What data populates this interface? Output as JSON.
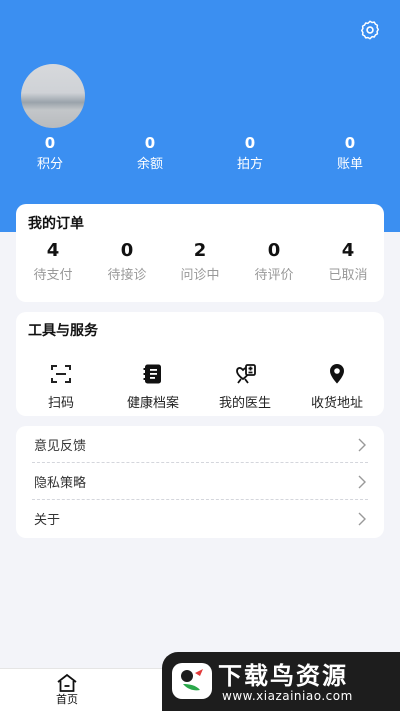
{
  "profile": {
    "stats": [
      {
        "value": "0",
        "label": "积分"
      },
      {
        "value": "0",
        "label": "余额"
      },
      {
        "value": "0",
        "label": "拍方"
      },
      {
        "value": "0",
        "label": "账单"
      }
    ]
  },
  "orders": {
    "title": "我的订单",
    "items": [
      {
        "value": "4",
        "label": "待支付"
      },
      {
        "value": "0",
        "label": "待接诊"
      },
      {
        "value": "2",
        "label": "问诊中"
      },
      {
        "value": "0",
        "label": "待评价"
      },
      {
        "value": "4",
        "label": "已取消"
      }
    ]
  },
  "tools": {
    "title": "工具与服务",
    "items": [
      {
        "label": "扫码",
        "icon": "scan-icon"
      },
      {
        "label": "健康档案",
        "icon": "health-record-icon"
      },
      {
        "label": "我的医生",
        "icon": "doctor-icon"
      },
      {
        "label": "收货地址",
        "icon": "location-pin-icon"
      }
    ]
  },
  "links": [
    {
      "label": "意见反馈"
    },
    {
      "label": "隐私策略"
    },
    {
      "label": "关于"
    }
  ],
  "tabbar": {
    "home_label": "首页"
  },
  "watermark": {
    "title": "下载鸟资源",
    "url": "www.xiazainiao.com"
  },
  "colors": {
    "header": "#3b8ff1",
    "background": "#f3f4f9"
  }
}
